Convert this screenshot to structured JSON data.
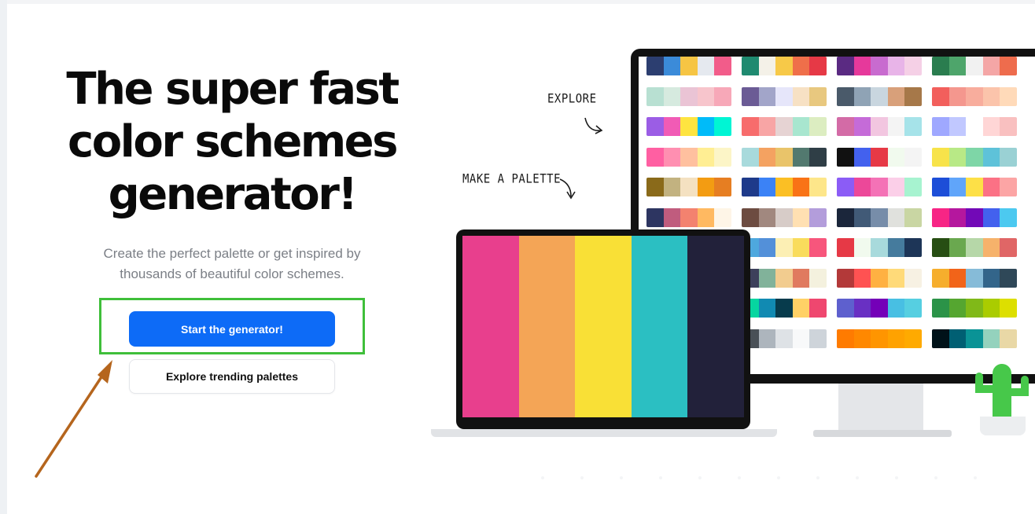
{
  "hero": {
    "title_lines": [
      "The super fast",
      "color schemes",
      "generator!"
    ],
    "subtitle_lines": [
      "Create the perfect palette or get inspired by",
      "thousands of beautiful color schemes."
    ],
    "primary_button": "Start the generator!",
    "secondary_button": "Explore trending palettes"
  },
  "annotations": {
    "explore": "EXPLORE",
    "make_palette": "MAKE A PALETTE"
  },
  "colors": {
    "primary_button_bg": "#0d6bf7",
    "highlight_box": "#3fbf3a",
    "annotation_arrow": "#b5651d",
    "cactus": "#47c84a"
  },
  "laptop_palette": [
    "#e83f8d",
    "#f4a556",
    "#f9e036",
    "#2bbfc2",
    "#22213a"
  ],
  "monitor_palettes": [
    [
      "#2c3e70",
      "#3b8bd9",
      "#f6c544",
      "#e5e9ef",
      "#f25c8a"
    ],
    [
      "#1f8a70",
      "#f4f1e8",
      "#f7c948",
      "#ef6f4a",
      "#e63946"
    ],
    [
      "#5a2a82",
      "#e6399b",
      "#c86bcf",
      "#e8b4e8",
      "#f5d0e6"
    ],
    [
      "#2a7d4f",
      "#4ea56b",
      "#f1f1f1",
      "#f4a6a6",
      "#ee6c4d"
    ],
    [
      "#b8e0d2",
      "#d6eadf",
      "#eac4d5",
      "#f7c5cc",
      "#f7a8b8"
    ],
    [
      "#6b5b95",
      "#a2a5c9",
      "#e6e6fa",
      "#f7e1c4",
      "#e8c87f"
    ],
    [
      "#4a5a6a",
      "#8fa3b5",
      "#c9d6df",
      "#d8a07a",
      "#a67849"
    ],
    [
      "#f25f5c",
      "#f4978e",
      "#f8ad9d",
      "#fbc4ab",
      "#ffdab9"
    ],
    [
      "#9b5de5",
      "#f15bb5",
      "#fee440",
      "#00bbf9",
      "#00f5d4"
    ],
    [
      "#f76c6c",
      "#f8a5a5",
      "#e6d3d3",
      "#a8e6cf",
      "#dcedc1"
    ],
    [
      "#d36ba6",
      "#c56bd8",
      "#f2c6e0",
      "#f4f4f4",
      "#a6e3e9"
    ],
    [
      "#9fa8ff",
      "#c1c8ff",
      "#ffffff",
      "#ffd6d6",
      "#f9c0c0"
    ],
    [
      "#ff5fa2",
      "#ff8fb1",
      "#ffc09f",
      "#ffee93",
      "#fcf5c7"
    ],
    [
      "#a8dadc",
      "#f4a261",
      "#e9c46a",
      "#52796f",
      "#2f3e46"
    ],
    [
      "#111111",
      "#4361ee",
      "#e63946",
      "#f1faee",
      "#f4f4f4"
    ],
    [
      "#f7e34a",
      "#b8e986",
      "#7ed6a7",
      "#5ec2d9",
      "#9ad1d4"
    ],
    [
      "#8a6a1a",
      "#c2b280",
      "#f4e1c1",
      "#f39c12",
      "#e67e22"
    ],
    [
      "#1e3a8a",
      "#3b82f6",
      "#fbbf24",
      "#f97316",
      "#fde68a"
    ],
    [
      "#8b5cf6",
      "#ec4899",
      "#f472b6",
      "#fbcfe8",
      "#a7f3d0"
    ],
    [
      "#1d4ed8",
      "#60a5fa",
      "#fde047",
      "#fb7185",
      "#fca5a5"
    ],
    [
      "#2d3561",
      "#c05c7e",
      "#f3826f",
      "#ffb961",
      "#fef5e7"
    ],
    [
      "#6d4c41",
      "#a1887f",
      "#d7ccc8",
      "#ffe0b2",
      "#b39ddb"
    ],
    [
      "#1b263b",
      "#415a77",
      "#778da9",
      "#e0e1dd",
      "#c9d6a3"
    ],
    [
      "#f72585",
      "#b5179e",
      "#7209b7",
      "#4361ee",
      "#4cc9f0"
    ],
    [
      "#2c7da0",
      "#61a5c2",
      "#a9d6e5",
      "#f4a261",
      "#e76f51"
    ],
    [
      "#4ea8de",
      "#5390d9",
      "#fcefb4",
      "#f9dc5c",
      "#f7567c"
    ],
    [
      "#e63946",
      "#f1faee",
      "#a8dadc",
      "#457b9d",
      "#1d3557"
    ],
    [
      "#274e13",
      "#6aa84f",
      "#b6d7a8",
      "#f6b26b",
      "#e06666"
    ],
    [
      "#ff6b6b",
      "#feca57",
      "#48dbfb",
      "#1dd1a1",
      "#5f27cd"
    ],
    [
      "#3d405b",
      "#81b29a",
      "#f2cc8f",
      "#e07a5f",
      "#f4f1de"
    ],
    [
      "#b33939",
      "#ff5252",
      "#ffb142",
      "#ffda79",
      "#f7f1e3"
    ],
    [
      "#f6ae2d",
      "#f26419",
      "#86bbd8",
      "#33658a",
      "#2f4858"
    ],
    [
      "#6d597a",
      "#b56576",
      "#e56b6f",
      "#eaac8b",
      "#ffcdb2"
    ],
    [
      "#06d6a0",
      "#118ab2",
      "#073b4c",
      "#ffd166",
      "#ef476f"
    ],
    [
      "#5e60ce",
      "#6930c3",
      "#7400b8",
      "#48bfe3",
      "#56cfe1"
    ],
    [
      "#2b9348",
      "#55a630",
      "#80b918",
      "#aacc00",
      "#dddf00"
    ],
    [
      "#e85d75",
      "#ff9b85",
      "#ffd97d",
      "#aaf683",
      "#60d394"
    ],
    [
      "#495057",
      "#adb5bd",
      "#dee2e6",
      "#f8f9fa",
      "#ced4da"
    ],
    [
      "#ff7b00",
      "#ff8800",
      "#ff9500",
      "#ffa200",
      "#ffaa00"
    ],
    [
      "#001219",
      "#005f73",
      "#0a9396",
      "#94d2bd",
      "#e9d8a6"
    ]
  ]
}
